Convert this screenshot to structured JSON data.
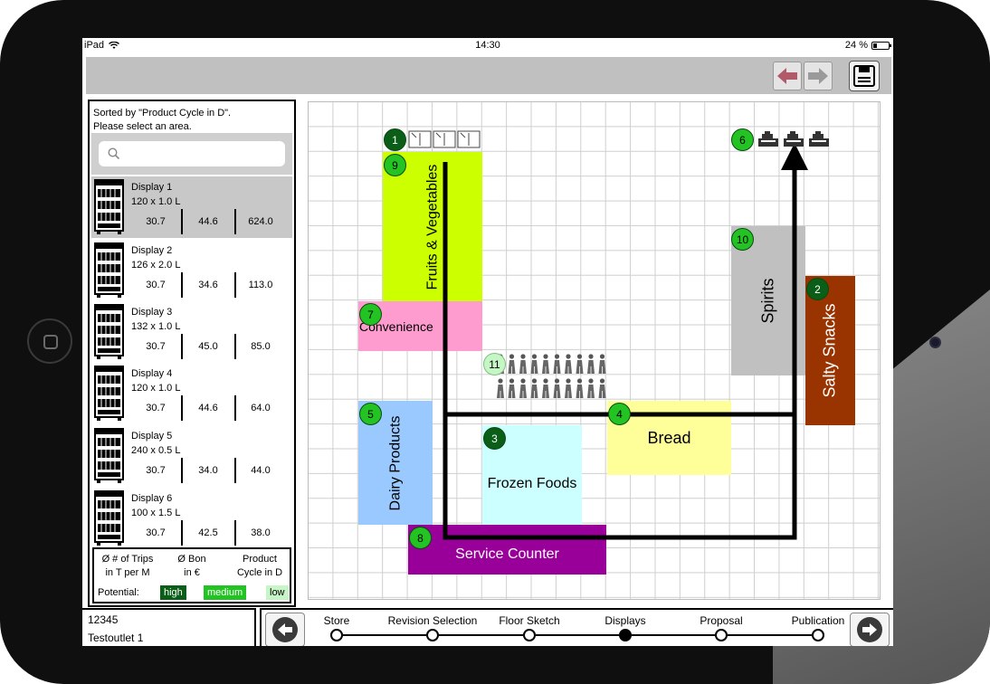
{
  "status_bar": {
    "device": "iPad",
    "time": "14:30",
    "battery": "24 %"
  },
  "toolbar": {
    "back_icon": "arrow-left-icon",
    "forward_icon": "arrow-right-icon",
    "save_icon": "floppy-save-icon"
  },
  "left_panel": {
    "sort_line1": "Sorted by \"Product Cycle in D\".",
    "sort_line2": "Please select an area.",
    "search_placeholder": "",
    "displays": [
      {
        "name": "Display 1",
        "size": "120 x 1.0 L",
        "trips": "30.7",
        "bon": "44.6",
        "cycle": "624.0",
        "selected": true
      },
      {
        "name": "Display 2",
        "size": "126 x 2.0 L",
        "trips": "30.7",
        "bon": "34.6",
        "cycle": "113.0",
        "selected": false
      },
      {
        "name": "Display 3",
        "size": "132 x 1.0 L",
        "trips": "30.7",
        "bon": "45.0",
        "cycle": "85.0",
        "selected": false
      },
      {
        "name": "Display 4",
        "size": "120 x 1.0 L",
        "trips": "30.7",
        "bon": "44.6",
        "cycle": "64.0",
        "selected": false
      },
      {
        "name": "Display 5",
        "size": "240 x 0.5 L",
        "trips": "30.7",
        "bon": "34.0",
        "cycle": "44.0",
        "selected": false
      },
      {
        "name": "Display 6",
        "size": "100 x 1.5 L",
        "trips": "30.7",
        "bon": "42.5",
        "cycle": "38.0",
        "selected": false
      }
    ],
    "legend": {
      "col1_a": "Ø # of Trips",
      "col1_b": "in T per M",
      "col2_a": "Ø Bon",
      "col2_b": "in €",
      "col3_a": "Product",
      "col3_b": "Cycle in D",
      "potential": "Potential:",
      "high": "high",
      "medium": "medium",
      "low": "low"
    }
  },
  "floor_plan": {
    "zones": {
      "fruits": "Fruits & Vegetables",
      "convenience": "Convenience",
      "dairy": "Dairy Products",
      "frozen": "Frozen Foods",
      "bread": "Bread",
      "service": "Service Counter",
      "spirits": "Spirits",
      "salty": "Salty Snacks"
    },
    "zone_colors": {
      "fruits": "#ccff00",
      "convenience": "#ff9ccf",
      "dairy": "#99c9ff",
      "frozen": "#ccffff",
      "bread": "#ffff99",
      "service": "#990099",
      "spirits": "#c0c0c0",
      "salty": "#993300"
    },
    "badges": {
      "b1": "1",
      "b2": "2",
      "b3": "3",
      "b4": "4",
      "b5": "5",
      "b6": "6",
      "b7": "7",
      "b8": "8",
      "b9": "9",
      "b10": "10",
      "b11": "11"
    }
  },
  "footer": {
    "store_id": "12345",
    "store_name": "Testoutlet 1",
    "steps": [
      "Store",
      "Revision Selection",
      "Floor Sketch",
      "Displays",
      "Proposal",
      "Publication"
    ],
    "active_step": 3
  }
}
